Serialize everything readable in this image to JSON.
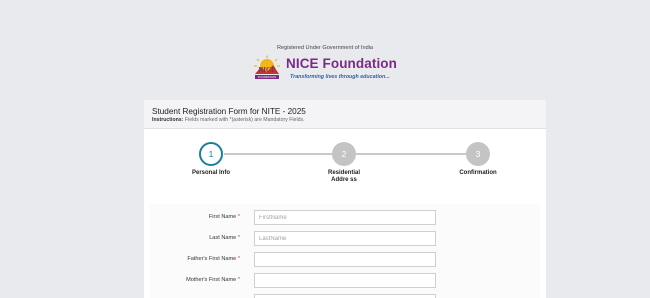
{
  "header": {
    "registered_text": "Registered Under Government of India",
    "org_name": "NICE Foundation",
    "tagline": "Transforming lives through education..."
  },
  "form": {
    "title": "Student Registration Form for NITE - 2025",
    "instructions_label": "Instructions:",
    "instructions_text": "Fields marked with *(asterisk) are Mandatory Fields."
  },
  "steps": [
    {
      "number": "1",
      "label": "Personal Info",
      "state": "active"
    },
    {
      "number": "2",
      "label": "Residential Addre ss",
      "state": "pending"
    },
    {
      "number": "3",
      "label": "Confirmation",
      "state": "pending"
    }
  ],
  "fields": [
    {
      "label": "First Name",
      "required": "*",
      "placeholder": "FirstName",
      "value": ""
    },
    {
      "label": "Last Name",
      "required": "*",
      "placeholder": "LastName",
      "value": ""
    },
    {
      "label": "Father's First Name",
      "required": "*",
      "placeholder": "",
      "value": ""
    },
    {
      "label": "Mother's First Name",
      "required": "*",
      "placeholder": "",
      "value": ""
    }
  ],
  "colors": {
    "brand_purple": "#7b2a86",
    "brand_blue": "#2f5fa8",
    "step_active": "#1b7e9c",
    "step_pending": "#c4c4c4"
  }
}
